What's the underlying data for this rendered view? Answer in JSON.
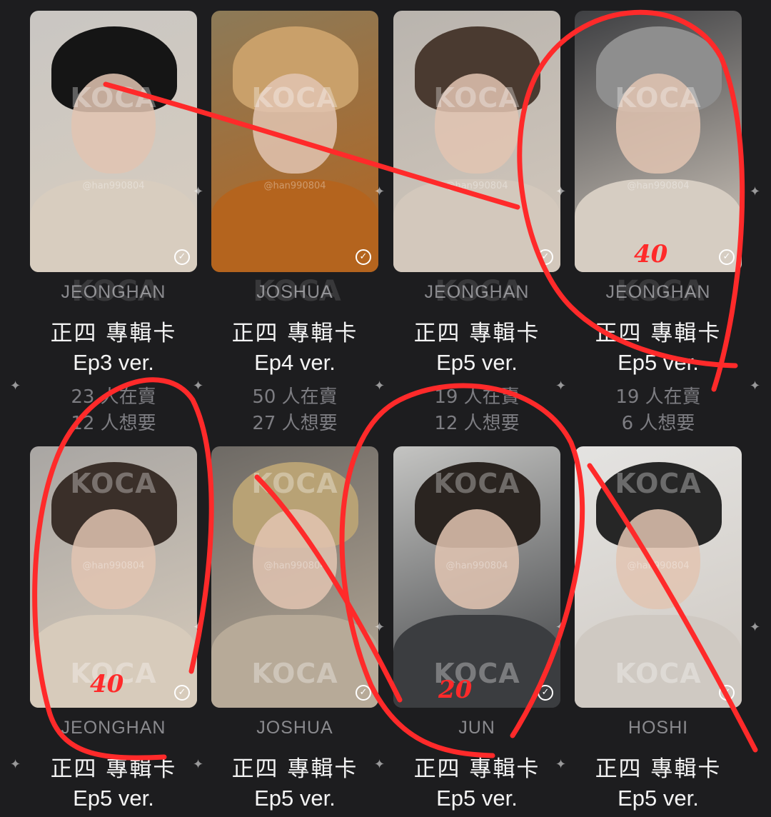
{
  "cards": [
    {
      "name": "JEONGHAN",
      "kind": "正四 專輯卡",
      "version": "Ep3 ver.",
      "selling": "23 人在賣",
      "wanting": "12 人想要",
      "colors": [
        "#c9c6c2",
        "#151515",
        "#d8cdbf"
      ]
    },
    {
      "name": "JOSHUA",
      "kind": "正四 專輯卡",
      "version": "Ep4 ver.",
      "selling": "50 人在賣",
      "wanting": "27 人想要",
      "colors": [
        "#8c7a58",
        "#c9a06a",
        "#b4641e"
      ]
    },
    {
      "name": "JEONGHAN",
      "kind": "正四 專輯卡",
      "version": "Ep5 ver.",
      "selling": "19 人在賣",
      "wanting": "12 人想要",
      "colors": [
        "#b9b4ae",
        "#4a3a30",
        "#d3c8bc"
      ]
    },
    {
      "name": "JEONGHAN",
      "kind": "正四 專輯卡",
      "version": "Ep5 ver.",
      "selling": "19 人在賣",
      "wanting": "6 人想要",
      "colors": [
        "#3e3f42",
        "#8e8e8e",
        "#d6cdc2"
      ]
    },
    {
      "name": "JEONGHAN",
      "kind": "正四 專輯卡",
      "version": "Ep5 ver.",
      "selling": "",
      "wanting": "",
      "colors": [
        "#a9a6a3",
        "#3a2f29",
        "#d7cbbb"
      ]
    },
    {
      "name": "JOSHUA",
      "kind": "正四 專輯卡",
      "version": "Ep5 ver.",
      "selling": "",
      "wanting": "",
      "colors": [
        "#6e6a65",
        "#b8a275",
        "#b7aa98"
      ]
    },
    {
      "name": "JUN",
      "kind": "正四 專輯卡",
      "version": "Ep5 ver.",
      "selling": "",
      "wanting": "",
      "colors": [
        "#c4c4c2",
        "#2a2420",
        "#3b3d40"
      ]
    },
    {
      "name": "HOSHI",
      "kind": "正四 專輯卡",
      "version": "Ep5 ver.",
      "selling": "",
      "wanting": "",
      "colors": [
        "#e4e3e1",
        "#262626",
        "#cfc9c2"
      ]
    }
  ],
  "watermark": "KOCA",
  "handle": "@han990804",
  "check_glyph": "✓",
  "sparkle_glyph": "✦",
  "annotations": {
    "color": "#ff2a2a",
    "prices": [
      "40",
      "40",
      "20"
    ]
  }
}
